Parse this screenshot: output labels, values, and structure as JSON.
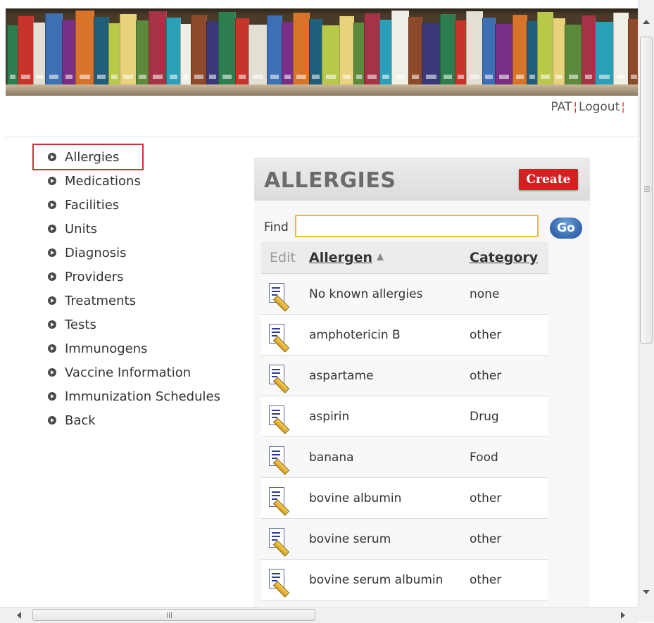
{
  "header": {
    "user_label": "PAT",
    "logout_label": "Logout"
  },
  "nav": {
    "items": [
      {
        "label": "Allergies",
        "selected": true
      },
      {
        "label": "Medications"
      },
      {
        "label": "Facilities"
      },
      {
        "label": "Units"
      },
      {
        "label": "Diagnosis"
      },
      {
        "label": "Providers"
      },
      {
        "label": "Treatments"
      },
      {
        "label": "Tests"
      },
      {
        "label": "Immunogens"
      },
      {
        "label": "Vaccine Information"
      },
      {
        "label": "Immunization Schedules"
      },
      {
        "label": "Back"
      }
    ]
  },
  "panel": {
    "title": "ALLERGIES",
    "create_label": "Create",
    "find_label": "Find",
    "find_value": "",
    "go_label": "Go"
  },
  "table": {
    "columns": {
      "edit": "Edit",
      "allergen": "Allergen",
      "category": "Category"
    },
    "sort_column": "allergen",
    "sort_direction": "ascending",
    "rows": [
      {
        "allergen": "No known allergies",
        "category": "none"
      },
      {
        "allergen": "amphotericin B",
        "category": "other"
      },
      {
        "allergen": "aspartame",
        "category": "other"
      },
      {
        "allergen": "aspirin",
        "category": "Drug"
      },
      {
        "allergen": "banana",
        "category": "Food"
      },
      {
        "allergen": "bovine albumin",
        "category": "other"
      },
      {
        "allergen": "bovine serum",
        "category": "other"
      },
      {
        "allergen": "bovine serum albumin",
        "category": "other"
      }
    ]
  },
  "icons": {
    "nav_bullet": "circle-arrow-right-icon",
    "row_edit": "document-pencil-icon",
    "sort": "sort-ascending-icon"
  },
  "colors": {
    "create_button": "#d42020",
    "selected_nav_outline": "#c8323a",
    "find_input_border": "#e8b84a",
    "go_button": "#1e4f9a",
    "header_separator": "#e63a2e"
  }
}
